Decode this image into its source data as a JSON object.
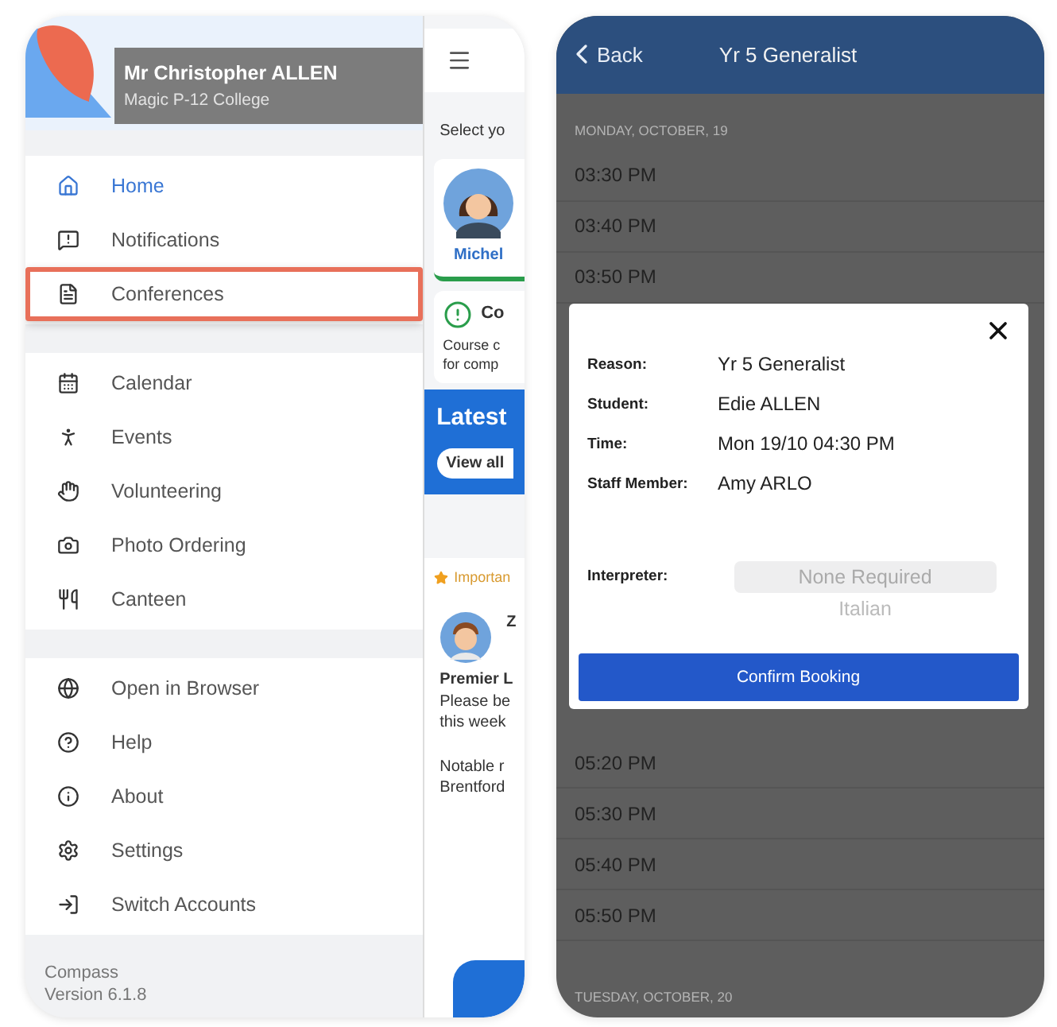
{
  "drawer": {
    "user_name": "Mr Christopher ALLEN",
    "school": "Magic P-12 College",
    "menu_groups": [
      [
        {
          "label": "Home",
          "selected": true,
          "highlighted": false
        },
        {
          "label": "Notifications",
          "selected": false,
          "highlighted": false
        },
        {
          "label": "Conferences",
          "selected": false,
          "highlighted": true
        }
      ],
      [
        {
          "label": "Calendar",
          "selected": false,
          "highlighted": false
        },
        {
          "label": "Events",
          "selected": false,
          "highlighted": false
        },
        {
          "label": "Volunteering",
          "selected": false,
          "highlighted": false
        },
        {
          "label": "Photo Ordering",
          "selected": false,
          "highlighted": false
        },
        {
          "label": "Canteen",
          "selected": false,
          "highlighted": false
        }
      ],
      [
        {
          "label": "Open in Browser",
          "selected": false,
          "highlighted": false
        },
        {
          "label": "Help",
          "selected": false,
          "highlighted": false
        },
        {
          "label": "About",
          "selected": false,
          "highlighted": false
        },
        {
          "label": "Settings",
          "selected": false,
          "highlighted": false
        },
        {
          "label": "Switch Accounts",
          "selected": false,
          "highlighted": false
        }
      ]
    ],
    "footer": [
      "Compass",
      "Version 6.1.8"
    ]
  },
  "home_peek": {
    "prompt": "Select yo",
    "student_name": "Michel",
    "alert_title": "Co",
    "alert_lines": [
      "Course c",
      "for comp"
    ],
    "section_title": "Latest",
    "view_all": "View all",
    "tag": "Importan",
    "post_author": "Z",
    "post_lines": [
      "Premier L",
      "Please be",
      "this week"
    ],
    "post_lines_2": [
      "Notable r",
      "Brentford"
    ]
  },
  "booking": {
    "back": "Back",
    "title": "Yr 5 Generalist",
    "day_1": "MONDAY, OCTOBER, 19",
    "slots_before": [
      "03:30 PM",
      "03:40 PM",
      "03:50 PM"
    ],
    "dialog": {
      "fields": [
        {
          "label": "Reason:",
          "value": "Yr 5 Generalist"
        },
        {
          "label": "Student:",
          "value": "Edie ALLEN"
        },
        {
          "label": "Time:",
          "value": "Mon 19/10 04:30 PM"
        },
        {
          "label": "Staff Member:",
          "value": "Amy ARLO"
        }
      ],
      "interpreter_label": "Interpreter:",
      "interpreter_options": [
        {
          "label": "None Required",
          "selected": true
        },
        {
          "label": "Italian",
          "selected": false
        }
      ],
      "confirm": "Confirm Booking"
    },
    "slots_after": [
      "05:20 PM",
      "05:30 PM",
      "05:40 PM",
      "05:50 PM"
    ],
    "day_2": "TUESDAY, OCTOBER, 20"
  }
}
